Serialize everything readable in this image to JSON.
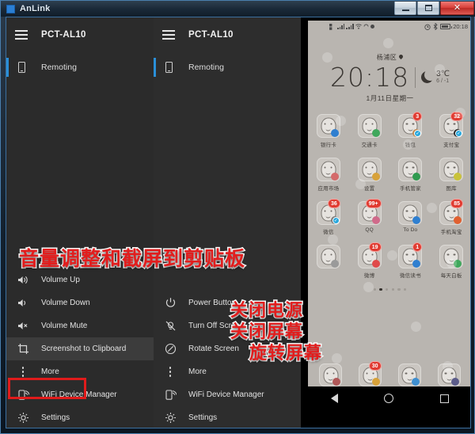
{
  "window": {
    "title": "AnLink",
    "app_icon": "anlink-logo-icon",
    "controls": {
      "minimize": "minimize-icon",
      "maximize": "maximize-icon",
      "close_label": "✕"
    }
  },
  "panel_left": {
    "menu_icon": "hamburger-icon",
    "device_name": "PCT-AL10",
    "nav": [
      {
        "label": "Remoting",
        "icon": "phone-icon",
        "active": true
      }
    ],
    "menu": [
      {
        "label": "Volume Up",
        "icon": "volume-up-icon",
        "highlight": false
      },
      {
        "label": "Volume Down",
        "icon": "volume-down-icon",
        "highlight": false
      },
      {
        "label": "Volume Mute",
        "icon": "volume-mute-icon",
        "highlight": false
      },
      {
        "label": "Screenshot to Clipboard",
        "icon": "crop-icon",
        "highlight": true
      },
      {
        "label": "More",
        "icon": "more-dots-icon",
        "highlight": false
      },
      {
        "label": "WiFi Device Manager",
        "icon": "wifi-device-icon",
        "highlight": false
      },
      {
        "label": "Settings",
        "icon": "gear-icon",
        "highlight": false
      }
    ]
  },
  "panel_right": {
    "menu_icon": "hamburger-icon",
    "device_name": "PCT-AL10",
    "nav": [
      {
        "label": "Remoting",
        "icon": "phone-icon",
        "active": true
      }
    ],
    "menu": [
      {
        "label": "Power Button",
        "icon": "power-icon",
        "highlight": false
      },
      {
        "label": "Turn Off Screen",
        "icon": "screen-off-icon",
        "highlight": false
      },
      {
        "label": "Rotate Screen",
        "icon": "rotate-icon",
        "highlight": false
      },
      {
        "label": "More",
        "icon": "more-dots-icon",
        "highlight": false
      },
      {
        "label": "WiFi Device Manager",
        "icon": "wifi-device-icon",
        "highlight": false
      },
      {
        "label": "Settings",
        "icon": "gear-icon",
        "highlight": false
      }
    ]
  },
  "annotations": {
    "color": "#e21d1d",
    "top": "音量调整和截屏到剪贴板",
    "right_1": "关闭电源",
    "right_2": "关闭屏幕",
    "right_3": "旋转屏幕"
  },
  "phone": {
    "status_bar": {
      "time": "20:18",
      "icons_left": [
        "sim-icon",
        "signal-1-icon",
        "signal-2-icon",
        "wifi-icon",
        "sync-icon",
        "dot-icon"
      ],
      "icons_right": [
        "alarm-icon",
        "bluetooth-icon",
        "battery-icon"
      ]
    },
    "clock_widget": {
      "location": "杨浦区",
      "time": "20:18",
      "weather_icon": "moon-icon",
      "temperature": "3℃",
      "temp_range": "6 / -1",
      "date": "1月11日星期一"
    },
    "apps": [
      {
        "name": "银行卡",
        "badge": "",
        "verified": false,
        "blob": "#2f7fd0"
      },
      {
        "name": "交通卡",
        "badge": "",
        "verified": false,
        "blob": "#3fa85c"
      },
      {
        "name": "钱包",
        "badge": "3",
        "verified": true,
        "blob": "#c08a52"
      },
      {
        "name": "支付宝",
        "badge": "32",
        "verified": true,
        "blob": "#2b2b2b"
      },
      {
        "name": "应用市场",
        "badge": "",
        "verified": false,
        "blob": "#d46a6a"
      },
      {
        "name": "设置",
        "badge": "",
        "verified": false,
        "blob": "#d8a23a"
      },
      {
        "name": "手机管家",
        "badge": "",
        "verified": false,
        "blob": "#2f9a4f"
      },
      {
        "name": "图库",
        "badge": "",
        "verified": false,
        "blob": "#c9c23a"
      },
      {
        "name": "微信",
        "badge": "36",
        "verified": true,
        "blob": "#7c7c7c"
      },
      {
        "name": "QQ",
        "badge": "99+",
        "verified": false,
        "blob": "#d06a8a"
      },
      {
        "name": "To Do",
        "badge": "",
        "verified": false,
        "blob": "#2f7fd0"
      },
      {
        "name": "手机淘宝",
        "badge": "85",
        "verified": false,
        "blob": "#e06030"
      },
      {
        "name": "",
        "badge": "",
        "verified": false,
        "blob": "#9a9a9a"
      },
      {
        "name": "微博",
        "badge": "19",
        "verified": false,
        "blob": "#e04a4a"
      },
      {
        "name": "微信读书",
        "badge": "1",
        "verified": false,
        "blob": "#2f7fd0"
      },
      {
        "name": "每天白板",
        "badge": "",
        "verified": false,
        "blob": "#3fa85c"
      }
    ],
    "page_dots": {
      "count": 6,
      "active_index": 1
    },
    "dock": [
      {
        "name": "dock-app-1",
        "badge": "",
        "blob": "#b05858"
      },
      {
        "name": "dock-app-2",
        "badge": "30",
        "blob": "#d8a23a"
      },
      {
        "name": "dock-app-3",
        "badge": "",
        "blob": "#3f8fd0"
      },
      {
        "name": "dock-app-4",
        "badge": "",
        "blob": "#5c5c8a"
      }
    ],
    "navbar": {
      "back": "back-triangle-icon",
      "home": "home-circle-icon",
      "recents": "recents-square-icon"
    }
  }
}
